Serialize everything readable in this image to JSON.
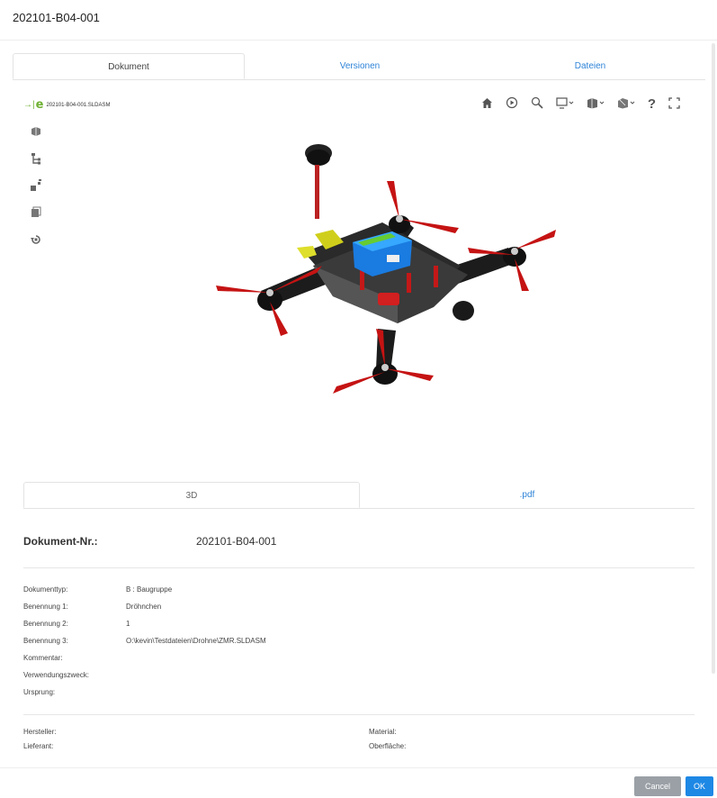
{
  "dialog": {
    "title": "202101-B04-001"
  },
  "tabs": [
    {
      "label": "Dokument",
      "active": true
    },
    {
      "label": "Versionen",
      "active": false
    },
    {
      "label": "Dateien",
      "active": false
    }
  ],
  "viewer": {
    "file_name": "202101-B04-001.SLDASM",
    "left_tools": [
      "parts-icon",
      "structure-icon",
      "explode-icon",
      "layers-icon",
      "rotate-icon"
    ],
    "top_tools": [
      "home-icon",
      "play-icon",
      "zoom-icon",
      "display-icon",
      "view-cube-icon",
      "section-icon",
      "help-icon",
      "fullscreen-icon"
    ]
  },
  "subtabs": [
    {
      "label": "3D",
      "active": true
    },
    {
      "label": ".pdf",
      "active": false
    }
  ],
  "document": {
    "nr_label": "Dokument-Nr.:",
    "nr_value": "202101-B04-001"
  },
  "properties": [
    {
      "label": "Dokumenttyp:",
      "value": "B : Baugruppe"
    },
    {
      "label": "Benennung 1:",
      "value": "Dröhnchen"
    },
    {
      "label": "Benennung 2:",
      "value": "1"
    },
    {
      "label": "Benennung 3:",
      "value": "O:\\kevin\\Testdateien\\Drohne\\ZMR.SLDASM"
    },
    {
      "label": "Kommentar:",
      "value": ""
    },
    {
      "label": "Verwendungszweck:",
      "value": ""
    },
    {
      "label": "Ursprung:",
      "value": ""
    }
  ],
  "properties2": {
    "left": [
      "Hersteller:",
      "Lieferant:"
    ],
    "right": [
      "Material:",
      "Oberfläche:"
    ]
  },
  "footer": {
    "cancel_label": "Cancel",
    "ok_label": "OK"
  },
  "colors": {
    "accent": "#1e88e5",
    "link": "#2f84d8",
    "cancel": "#9aa0a6",
    "logo": "#6fb133"
  }
}
